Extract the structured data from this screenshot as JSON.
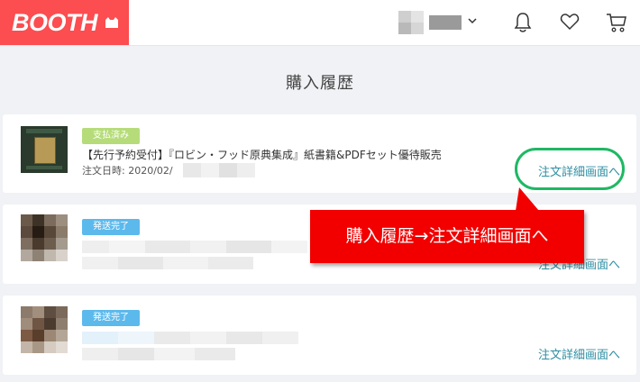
{
  "header": {
    "logo": "BOOTH",
    "icons": [
      "chevron-down-icon",
      "bell-icon",
      "heart-icon",
      "cart-icon"
    ]
  },
  "page_title": "購入履歴",
  "orders": [
    {
      "status": "支払済み",
      "status_color": "#b6dc7a",
      "title": "【先行予約受付】『ロビン・フッド原典集成』紙書籍&PDFセット優待販売",
      "order_date": "注文日時: 2020/02/",
      "detail_link": "注文詳細画面へ"
    },
    {
      "status": "発送完了",
      "status_color": "#5cb9ec",
      "detail_link": "注文詳細画面へ"
    },
    {
      "status": "発送完了",
      "status_color": "#5cb9ec",
      "detail_link": "注文詳細画面へ"
    }
  ],
  "annotation": {
    "text": "購入履歴→注文詳細画面へ",
    "box_color": "#f20000",
    "ring_color": "#1fb864"
  },
  "colors": {
    "brand": "#fc4d50",
    "link": "#2d8ea3",
    "background": "#f0f2f5"
  }
}
